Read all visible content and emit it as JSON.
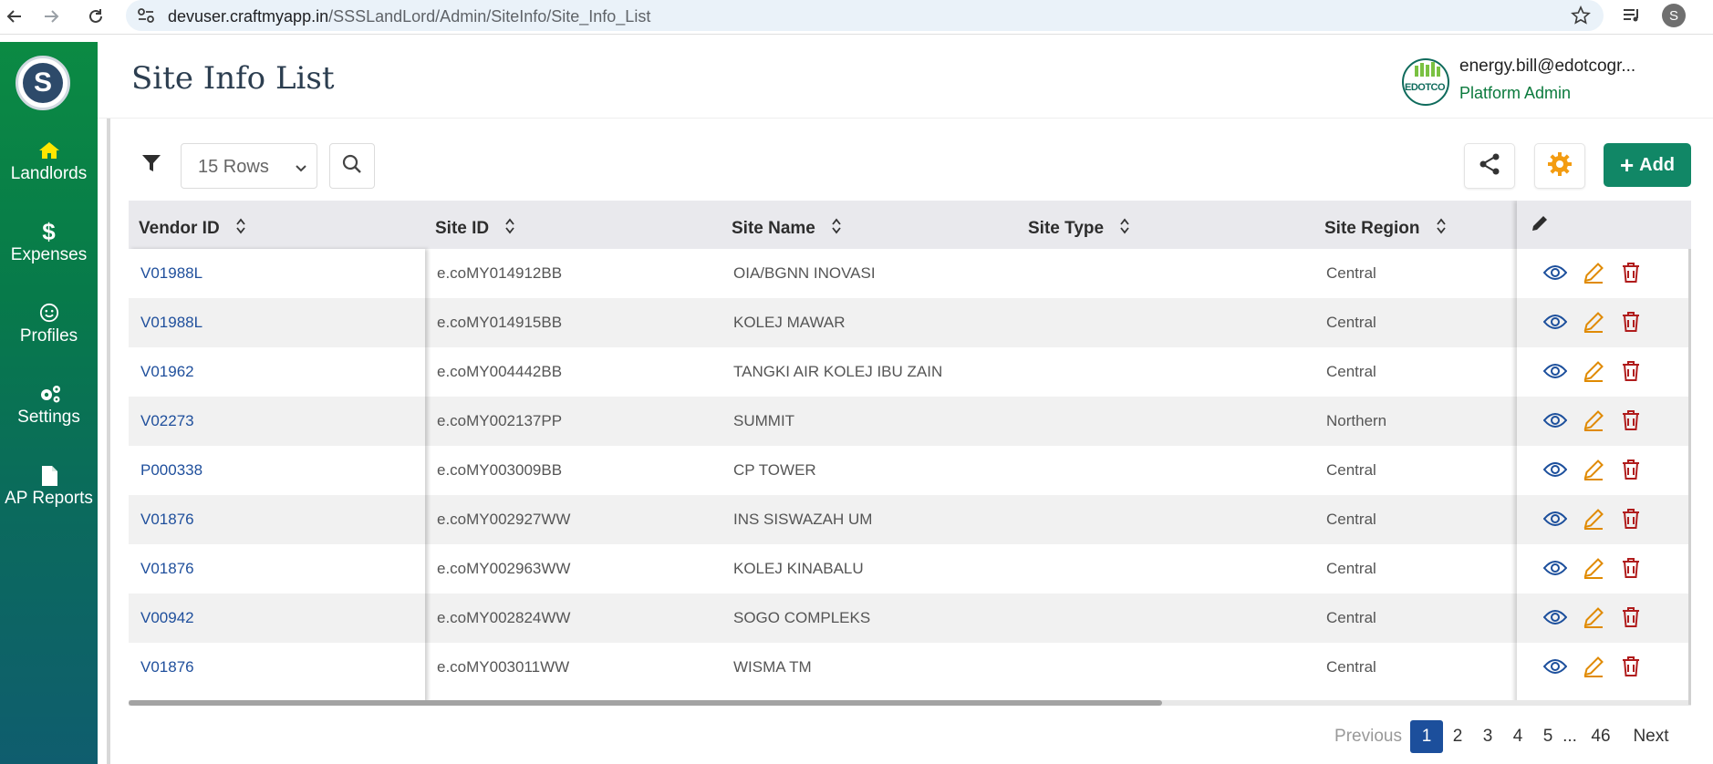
{
  "browser": {
    "url_host": "devuser.craftmyapp.in",
    "url_path": "/SSSLandLord/Admin/SiteInfo/Site_Info_List",
    "profile_initial": "S"
  },
  "sidebar": {
    "logo_letter": "S",
    "items": [
      {
        "label": "Landlords",
        "icon": "home-icon"
      },
      {
        "label": "Expenses",
        "icon": "dollar-icon"
      },
      {
        "label": "Profiles",
        "icon": "smiley-icon"
      },
      {
        "label": "Settings",
        "icon": "gears-icon"
      },
      {
        "label": "AP Reports",
        "icon": "document-icon"
      }
    ],
    "accent_color": "#0b8a43",
    "highlight_color": "#ffe600"
  },
  "header": {
    "title": "Site Info List",
    "user_email": "energy.bill@edotcogr...",
    "user_role": "Platform Admin",
    "avatar_text": "EDOTCO"
  },
  "toolbar": {
    "rows_selected": "15 Rows",
    "add_label": "Add",
    "brand_color": "#118766"
  },
  "table": {
    "columns": [
      "Vendor ID",
      "Site ID",
      "Site Name",
      "Site Type",
      "Site Region"
    ],
    "rows": [
      {
        "vendor": "V01988L",
        "site_id": "e.coMY014912BB",
        "site_name": "OIA/BGNN INOVASI",
        "site_type": "",
        "region": "Central"
      },
      {
        "vendor": "V01988L",
        "site_id": "e.coMY014915BB",
        "site_name": "KOLEJ MAWAR",
        "site_type": "",
        "region": "Central"
      },
      {
        "vendor": "V01962",
        "site_id": "e.coMY004442BB",
        "site_name": "TANGKI AIR KOLEJ IBU ZAIN",
        "site_type": "",
        "region": "Central"
      },
      {
        "vendor": "V02273",
        "site_id": "e.coMY002137PP",
        "site_name": "SUMMIT",
        "site_type": "",
        "region": "Northern"
      },
      {
        "vendor": "P000338",
        "site_id": "e.coMY003009BB",
        "site_name": "CP TOWER",
        "site_type": "",
        "region": "Central"
      },
      {
        "vendor": "V01876",
        "site_id": "e.coMY002927WW",
        "site_name": "INS SISWAZAH UM",
        "site_type": "",
        "region": "Central"
      },
      {
        "vendor": "V01876",
        "site_id": "e.coMY002963WW",
        "site_name": "KOLEJ KINABALU",
        "site_type": "",
        "region": "Central"
      },
      {
        "vendor": "V00942",
        "site_id": "e.coMY002824WW",
        "site_name": "SOGO COMPLEKS",
        "site_type": "",
        "region": "Central"
      },
      {
        "vendor": "V01876",
        "site_id": "e.coMY003011WW",
        "site_name": "WISMA TM",
        "site_type": "",
        "region": "Central"
      }
    ]
  },
  "pagination": {
    "previous": "Previous",
    "pages": [
      "1",
      "2",
      "3",
      "4",
      "5"
    ],
    "ellipsis": "...",
    "last": "46",
    "next": "Next",
    "current": "1"
  }
}
